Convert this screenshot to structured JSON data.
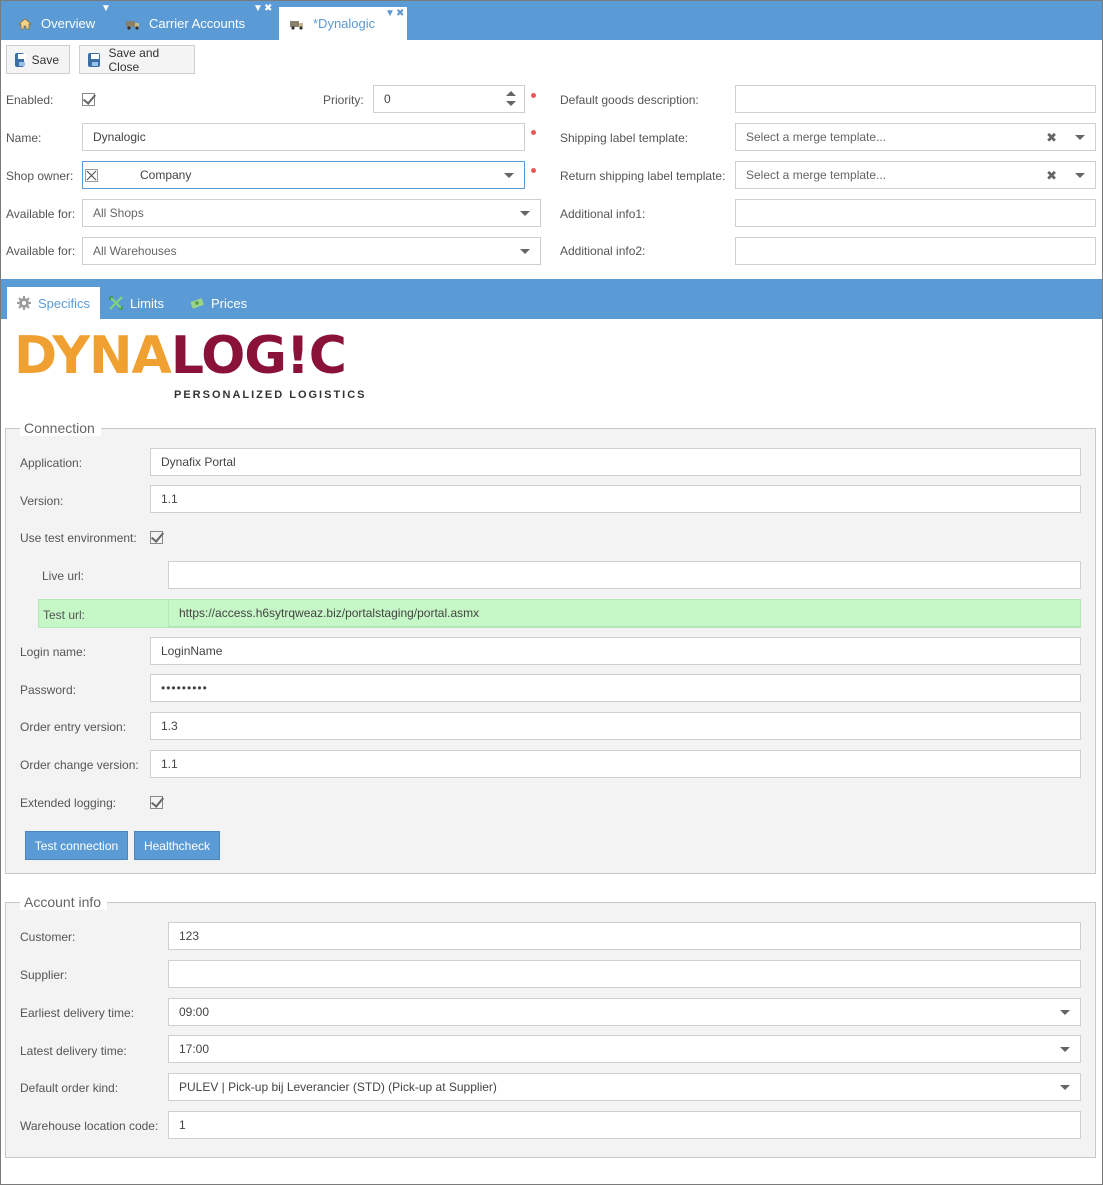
{
  "tabs": [
    {
      "label": "Overview",
      "icon": "home-icon"
    },
    {
      "label": "Carrier Accounts",
      "icon": "truck-icon"
    },
    {
      "label": "*Dynalogic",
      "icon": "truck-icon"
    }
  ],
  "toolbar": {
    "save_label": "Save",
    "save_close_label": "Save and Close"
  },
  "general": {
    "enabled_label": "Enabled:",
    "priority_label": "Priority:",
    "priority_value": "0",
    "name_label": "Name:",
    "name_value": "Dynalogic",
    "shop_owner_label": "Shop owner:",
    "shop_owner_value": "Company",
    "available_shops_label": "Available for:",
    "available_shops_value": "All Shops",
    "available_warehouses_label": "Available for:",
    "available_warehouses_value": "All Warehouses",
    "default_goods_label": "Default goods description:",
    "default_goods_value": "",
    "shipping_template_label": "Shipping label template:",
    "shipping_template_placeholder": "Select a merge template...",
    "return_template_label": "Return shipping label template:",
    "return_template_placeholder": "Select a merge template...",
    "additional1_label": "Additional info1:",
    "additional1_value": "",
    "additional2_label": "Additional info2:",
    "additional2_value": ""
  },
  "subtabs": [
    {
      "label": "Specifics",
      "icon": "gear-icon"
    },
    {
      "label": "Limits",
      "icon": "limits-icon"
    },
    {
      "label": "Prices",
      "icon": "money-icon"
    }
  ],
  "logo": {
    "part1": "DYNA",
    "part2": "LOG!C",
    "tagline": "PERSONALIZED LOGISTICS"
  },
  "connection": {
    "legend": "Connection",
    "application_label": "Application:",
    "application_value": "Dynafix Portal",
    "version_label": "Version:",
    "version_value": "1.1",
    "use_test_label": "Use test environment:",
    "live_url_label": "Live url:",
    "live_url_value": "",
    "test_url_label": "Test url:",
    "test_url_value": "https://access.h6sytrqweaz.biz/portalstaging/portal.asmx",
    "login_label": "Login name:",
    "login_value": "LoginName",
    "password_label": "Password:",
    "password_value": "•••••••••",
    "order_entry_label": "Order entry version:",
    "order_entry_value": "1.3",
    "order_change_label": "Order change version:",
    "order_change_value": "1.1",
    "extended_logging_label": "Extended logging:",
    "test_connection_label": "Test connection",
    "healthcheck_label": "Healthcheck"
  },
  "account": {
    "legend": "Account info",
    "customer_label": "Customer:",
    "customer_value": "123",
    "supplier_label": "Supplier:",
    "supplier_value": "",
    "earliest_label": "Earliest delivery time:",
    "earliest_value": "09:00",
    "latest_label": "Latest delivery time:",
    "latest_value": "17:00",
    "order_kind_label": "Default order kind:",
    "order_kind_value": "PULEV | Pick-up bij Leverancier (STD) (Pick-up at Supplier)",
    "warehouse_label": "Warehouse location code:",
    "warehouse_value": "1"
  },
  "colors": {
    "accent": "#5b9bd5",
    "highlight": "#c6f7c6",
    "logo_orange": "#f0a030",
    "logo_maroon": "#8a1238",
    "required": "#e85a5a"
  }
}
